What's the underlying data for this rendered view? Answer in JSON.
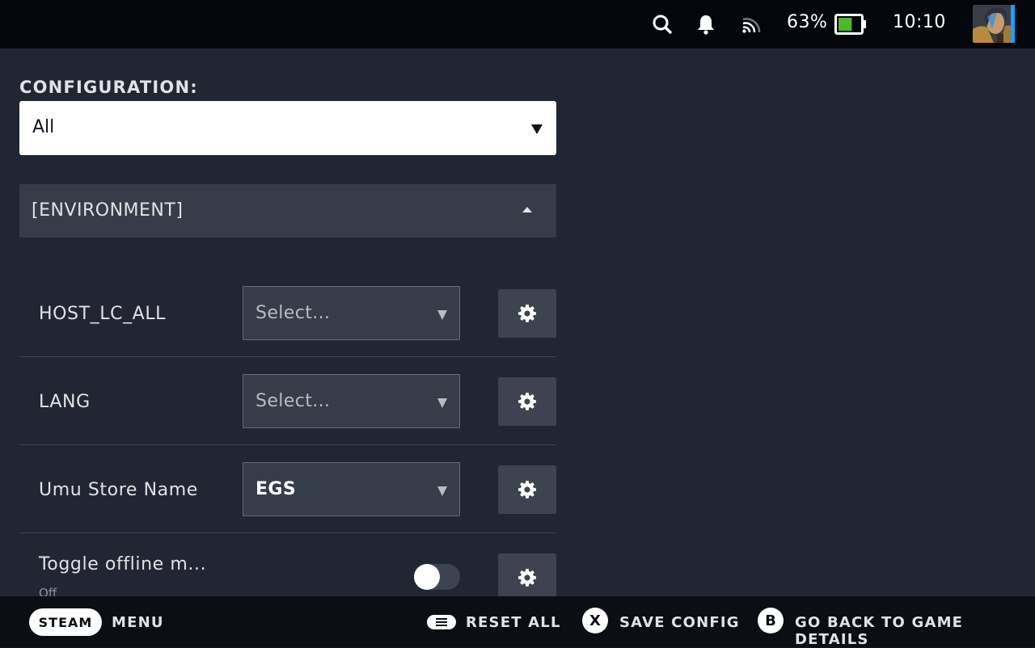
{
  "status_bar": {
    "battery_percent": "63%",
    "battery_level": 0.63,
    "battery_color": "#4cb82d",
    "time": "10:10",
    "icons": [
      "search-icon",
      "bell-icon",
      "cast-icon",
      "battery-icon",
      "avatar"
    ]
  },
  "configuration": {
    "label": "CONFIGURATION:",
    "selected": "All"
  },
  "section": {
    "title": "[ENVIRONMENT]"
  },
  "settings": [
    {
      "label": "HOST_LC_ALL",
      "value": "Select...",
      "has_value": false
    },
    {
      "label": "LANG",
      "value": "Select...",
      "has_value": false
    },
    {
      "label": "Umu Store Name",
      "value": "EGS",
      "has_value": true
    },
    {
      "label": "Toggle offline m...",
      "sublabel": "Off",
      "toggle_on": false
    }
  ],
  "bottom_bar": {
    "steam": "STEAM",
    "menu": "MENU",
    "reset_all": "RESET ALL",
    "x_glyph": "X",
    "save_config": "SAVE CONFIG",
    "b_glyph": "B",
    "go_back": "GO BACK TO GAME DETAILS"
  }
}
